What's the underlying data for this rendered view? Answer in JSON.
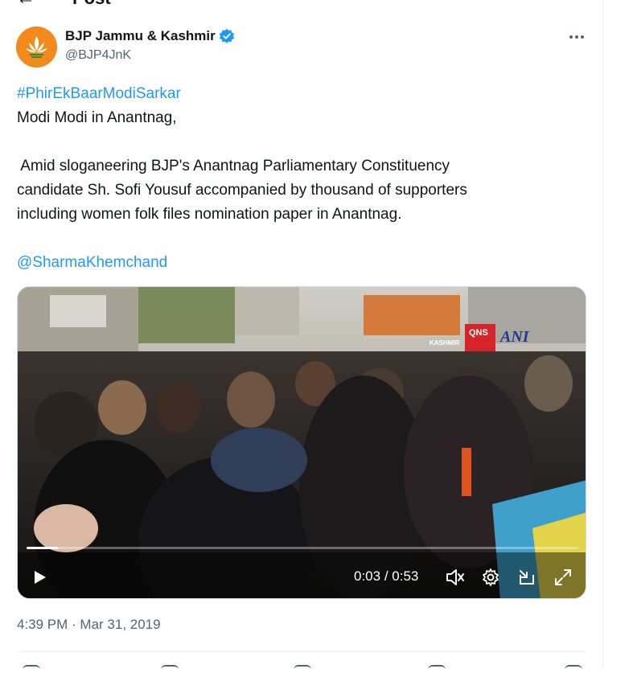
{
  "header": {
    "back_icon": "arrow-left-icon",
    "title": "Post"
  },
  "author": {
    "avatar_icon": "lotus-logo-icon",
    "name": "BJP Jammu & Kashmir",
    "verified_icon": "verified-badge-icon",
    "verified_color": "#1d9bf0",
    "handle": "@BJP4JnK",
    "more_icon": "more-horizontal-icon"
  },
  "post": {
    "hashtag": "#PhirEkBaarModiSarkar",
    "line1": "Modi Modi in Anantnag,",
    "line2": " Amid sloganeering BJP's Anantnag Parliamentary Constituency",
    "line3": "candidate Sh. Sofi Yousuf accompanied by thousand of supporters",
    "line4": "including women folk files nomination paper in Anantnag.",
    "mention": "@SharmaKhemchand",
    "link_color": "#1d9bf0"
  },
  "video": {
    "watermarks": [
      "KASHMIR",
      "QNS",
      "ANI"
    ],
    "progress_fraction": 0.057,
    "current_time": "0:03",
    "separator": " / ",
    "duration": "0:53",
    "controls": [
      "play-icon",
      "mute-icon",
      "settings-icon",
      "pip-icon",
      "fullscreen-icon"
    ]
  },
  "meta": {
    "timestamp": "4:39 PM · Mar 31, 2019"
  }
}
